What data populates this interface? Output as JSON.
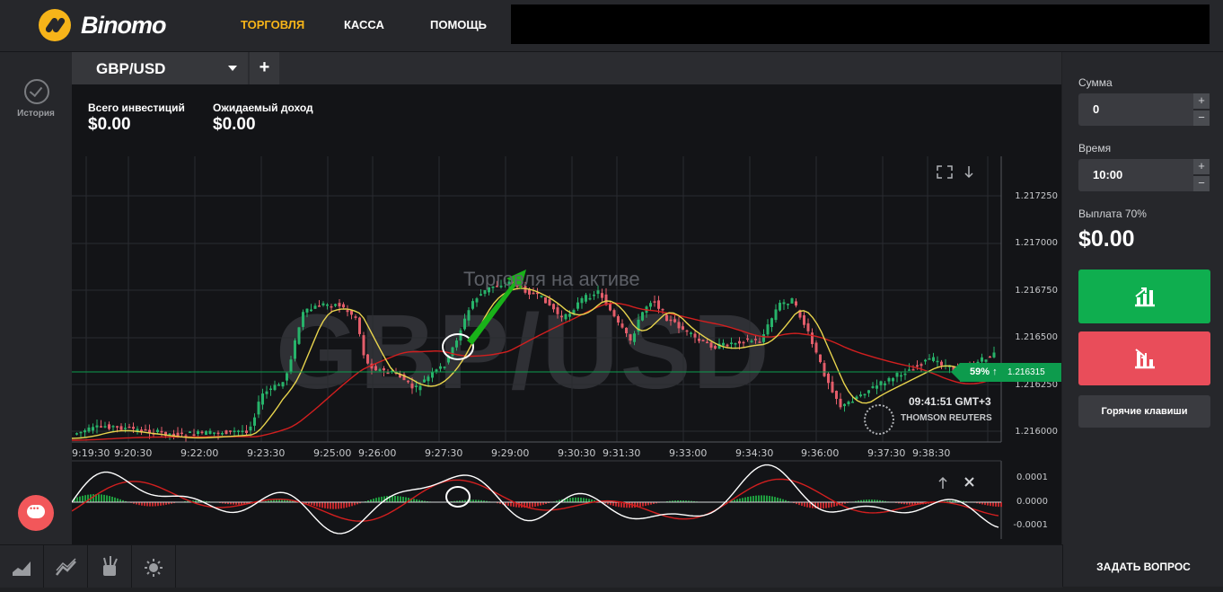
{
  "header": {
    "brand": "Binomo",
    "nav": [
      {
        "label": "ТОРГОВЛЯ",
        "active": true
      },
      {
        "label": "КАССА",
        "active": false
      },
      {
        "label": "ПОМОЩЬ",
        "active": false
      }
    ]
  },
  "sidebar": {
    "history_label": "История"
  },
  "tabs": {
    "asset": "GBP/USD",
    "add_label": "+"
  },
  "stats": {
    "invest_label": "Всего инвестиций",
    "invest_value": "$0.00",
    "income_label": "Ожидаемый доход",
    "income_value": "$0.00"
  },
  "chart": {
    "watermark": "GBP/USD",
    "overlay_text": "Торговля на активе",
    "current_marker": "59% ↑",
    "current_price": "1.216315",
    "clock": "09:41:51 GMT+3",
    "data_provider": "THOMSON REUTERS"
  },
  "chart_data": {
    "type": "candlestick",
    "y_ticks": [
      "1.217250",
      "1.217000",
      "1.216750",
      "1.216500",
      "1.216250",
      "1.216000"
    ],
    "x_ticks": [
      "9:19:30",
      "9:20:30",
      "9:22:00",
      "9:23:30",
      "9:25:00",
      "9:26:00",
      "9:27:30",
      "9:29:00",
      "9:30:30",
      "9:31:30",
      "9:33:00",
      "9:34:30",
      "9:36:00",
      "9:37:30",
      "9:38:30"
    ],
    "current_price": 1.216315,
    "payout_percent": 59,
    "oscillator_ticks": [
      "0.0001",
      "0.0000",
      "-0.0001"
    ],
    "indicators": [
      "yellow moving average",
      "red moving average",
      "oscillator white line",
      "oscillator red line",
      "histogram"
    ]
  },
  "panel": {
    "amount_label": "Сумма",
    "amount_value": "0",
    "time_label": "Время",
    "time_value": "10:00",
    "payout_label": "Выплата 70%",
    "payout_value": "$0.00",
    "hotkeys_label": "Горячие клавиши"
  },
  "footer": {
    "ask_label": "ЗАДАТЬ ВОПРОС"
  },
  "colors": {
    "brand": "#f6b419",
    "up": "#0fae4f",
    "down": "#e94d5a",
    "ma_yellow": "#e8d44d",
    "ma_red": "#d21f1f"
  }
}
